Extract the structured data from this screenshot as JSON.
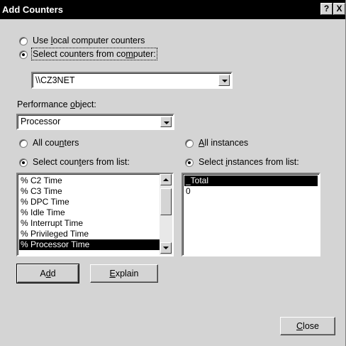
{
  "window": {
    "title": "Add Counters",
    "help_label": "?",
    "close_label": "X"
  },
  "source": {
    "local_label": "Use local computer counters",
    "remote_label": "Select counters from computer:",
    "selected": "remote",
    "computer_value": "\\\\CZ3NET"
  },
  "object": {
    "label": "Performance object:",
    "value": "Processor"
  },
  "counters": {
    "all_label": "All counters",
    "list_label": "Select counters from list:",
    "selected_mode": "list",
    "items": [
      "% C2 Time",
      "% C3 Time",
      "% DPC Time",
      "% Idle Time",
      "% Interrupt Time",
      "% Privileged Time",
      "% Processor Time"
    ],
    "selected_item": "% Processor Time"
  },
  "instances": {
    "all_label": "All instances",
    "list_label": "Select instances from list:",
    "selected_mode": "list",
    "items": [
      "_Total",
      "0"
    ],
    "selected_item": "_Total"
  },
  "buttons": {
    "add": "Add",
    "explain": "Explain",
    "close": "Close"
  }
}
